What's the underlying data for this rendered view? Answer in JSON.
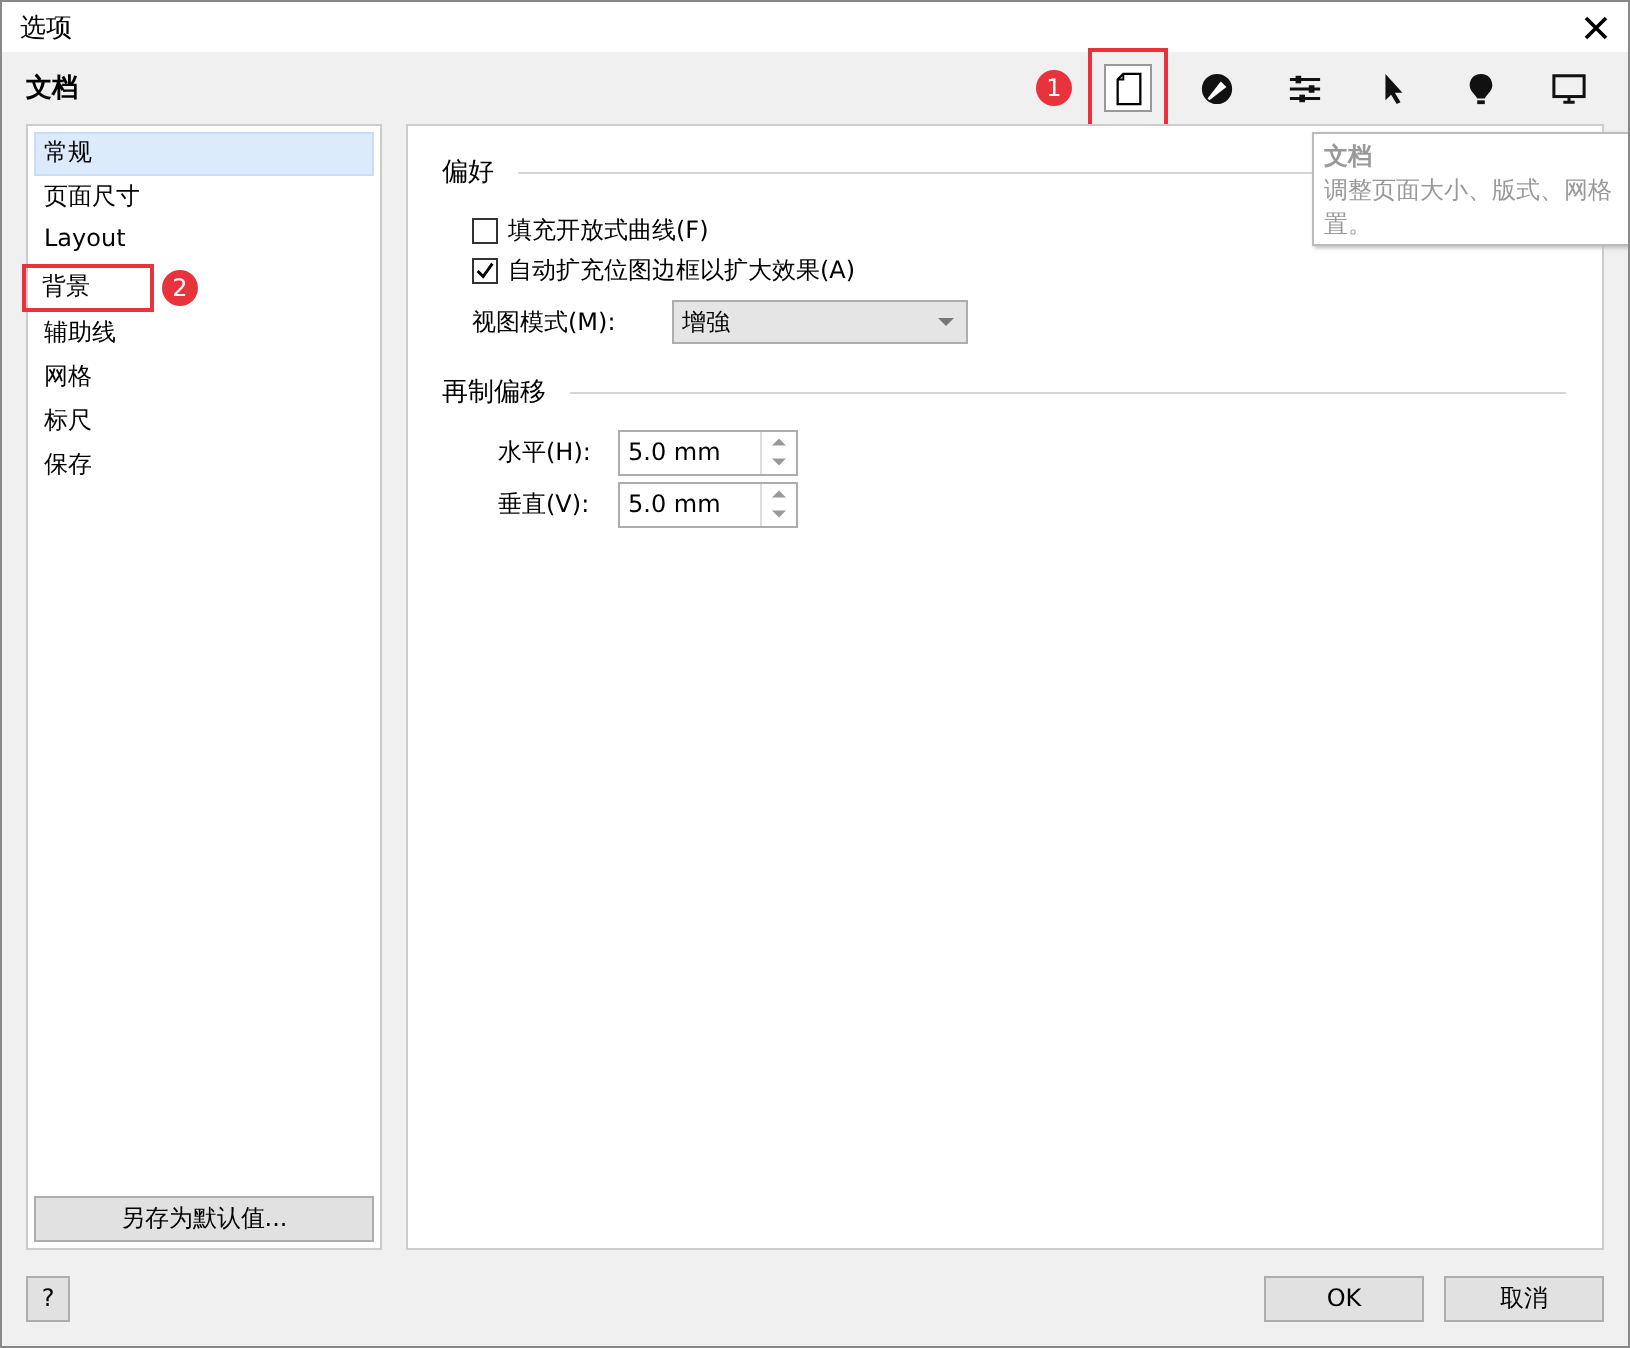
{
  "window": {
    "title": "选项"
  },
  "section_title": "文档",
  "toolbar": [
    {
      "kind": "page",
      "selected": true,
      "callout": "1"
    },
    {
      "kind": "pen",
      "selected": false
    },
    {
      "kind": "sliders",
      "selected": false
    },
    {
      "kind": "cursor",
      "selected": false
    },
    {
      "kind": "bulb",
      "selected": false
    },
    {
      "kind": "monitor",
      "selected": false
    }
  ],
  "tooltip": {
    "title": "文档",
    "lines": [
      "调整页面大小、版式、网格",
      "置。"
    ]
  },
  "tree": {
    "items": [
      {
        "label": "常规",
        "selected": true
      },
      {
        "label": "页面尺寸",
        "selected": false
      },
      {
        "label": "Layout",
        "selected": false
      },
      {
        "label": "背景",
        "selected": false,
        "callout": "2"
      },
      {
        "label": "辅助线",
        "selected": false
      },
      {
        "label": "网格",
        "selected": false
      },
      {
        "label": "标尺",
        "selected": false
      },
      {
        "label": "保存",
        "selected": false
      }
    ]
  },
  "save_default_button": "另存为默认值...",
  "groups": [
    {
      "title": "偏好",
      "controls": [
        {
          "kind": "checkbox",
          "label": "填充开放式曲线(F)",
          "checked": false
        },
        {
          "kind": "checkbox",
          "label": "自动扩充位图边框以扩大效果(A)",
          "checked": true
        },
        {
          "kind": "dropdown",
          "label": "视图模式(M):",
          "value": "增強"
        }
      ]
    },
    {
      "title": "再制偏移",
      "controls": [
        {
          "kind": "spinner",
          "label": "水平(H):",
          "value": "5.0 mm"
        },
        {
          "kind": "spinner",
          "label": "垂直(V):",
          "value": "5.0 mm"
        }
      ]
    }
  ],
  "help_button": "?",
  "buttons": [
    "OK",
    "取消"
  ]
}
